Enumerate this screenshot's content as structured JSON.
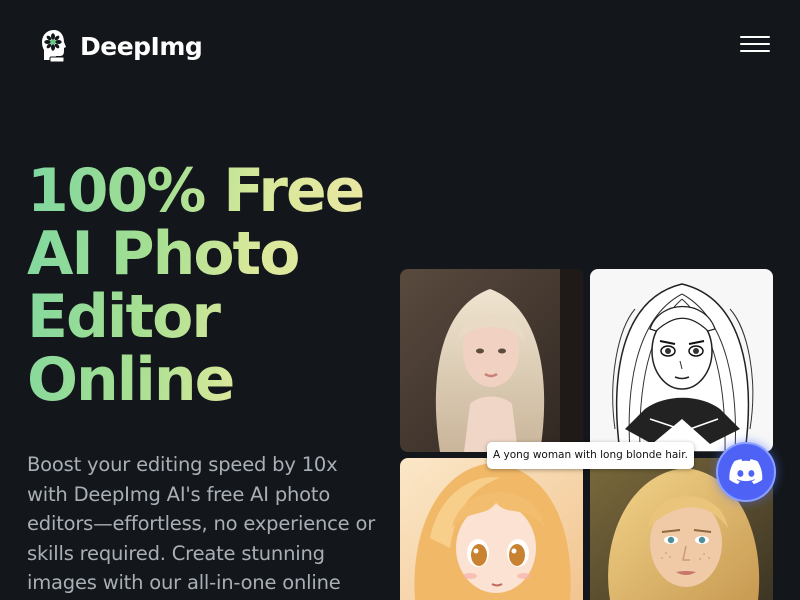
{
  "header": {
    "brand_name": "DeepImg",
    "logo_icon": "head-flower-logo-icon",
    "menu_icon": "hamburger-menu-icon"
  },
  "hero": {
    "title_lines": [
      "100% Free",
      "AI Photo",
      "Editor",
      "Online"
    ],
    "subtitle": "Boost your editing speed by 10x with DeepImg AI's free AI photo editors—effortless, no experience or skills required. Create stunning images with our all-in-one online"
  },
  "gallery": {
    "prompt_text": "A yong woman with long blonde hair.",
    "images": [
      "blonde-woman-photo",
      "manga-sketch-woman",
      "anime-girl-portrait",
      "realistic-blonde-woman-portrait"
    ]
  },
  "floating": {
    "discord_icon": "discord-icon"
  },
  "colors": {
    "background": "#13171b",
    "title_gradient_start": "#7ed7a0",
    "title_gradient_end": "#f3e6a6",
    "subtitle": "#a9afb6",
    "discord": "#4e62f5"
  }
}
